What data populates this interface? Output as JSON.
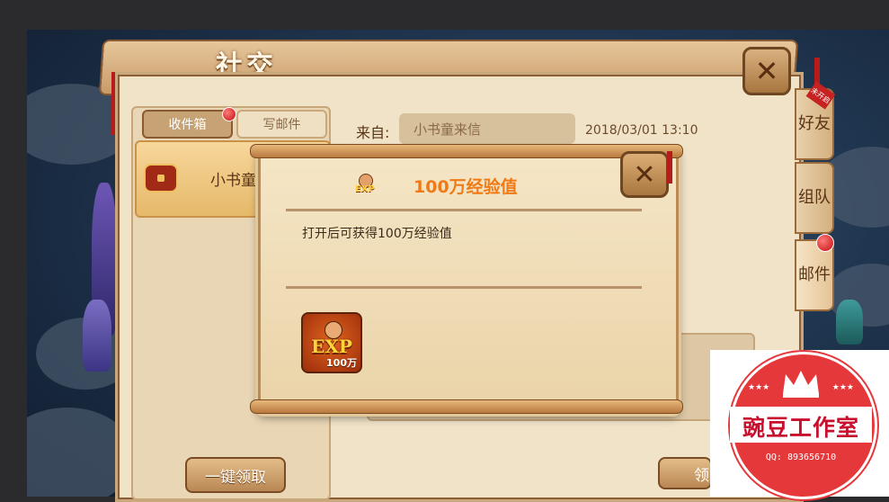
{
  "window": {
    "title": "社交"
  },
  "mail": {
    "tabs": [
      {
        "label": "收件箱",
        "active": true,
        "has_badge": true
      },
      {
        "label": "写邮件",
        "active": false,
        "has_badge": false
      }
    ],
    "list": [
      {
        "sender": "小书童",
        "icon": "treasure-chest-icon"
      }
    ],
    "claim_all_label": "一键领取"
  },
  "detail": {
    "from_label": "来自:",
    "from_value": "小书童来信",
    "date": "2018/03/01  13:10",
    "claim_label": "领"
  },
  "side_tabs": [
    {
      "label": "好友",
      "ribbon": "未开启"
    },
    {
      "label": "组队"
    },
    {
      "label": "邮件",
      "has_badge": true
    }
  ],
  "dialog": {
    "title": "100万经验值",
    "description": "打开后可获得100万经验值",
    "item": {
      "icon": "exp-icon",
      "label": "EXP",
      "amount": "100万"
    },
    "title_color": "#ef7a16"
  },
  "watermark": {
    "name": "豌豆工作室",
    "qq": "QQ: 893656710"
  },
  "colors": {
    "badge_red": "#d31414",
    "panel_bg": "#f1e3c8",
    "accent_orange": "#ef7a16"
  }
}
